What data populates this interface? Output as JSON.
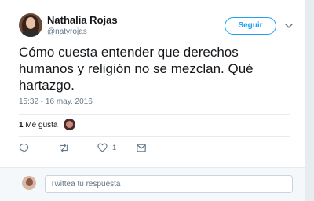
{
  "tweet": {
    "author": {
      "display_name": "Nathalia Rojas",
      "username": "@natyrojas"
    },
    "follow_button": "Seguir",
    "text": "Cómo cuesta entender que derechos humanos y religión no se mezclan. Qué hartazgo.",
    "timestamp": "15:32 - 16 may. 2016",
    "likes": {
      "count": "1",
      "label": "Me gusta"
    },
    "actions": {
      "like_count": "1"
    }
  },
  "reply": {
    "placeholder": "Twittea tu respuesta"
  },
  "icons": {
    "reply": "reply-icon",
    "retweet": "retweet-icon",
    "like": "heart-icon",
    "message": "envelope-icon",
    "more": "chevron-down-icon"
  },
  "colors": {
    "accent": "#1da1f2",
    "muted": "#657786",
    "text": "#14171a",
    "divider": "#e6ecf0"
  }
}
